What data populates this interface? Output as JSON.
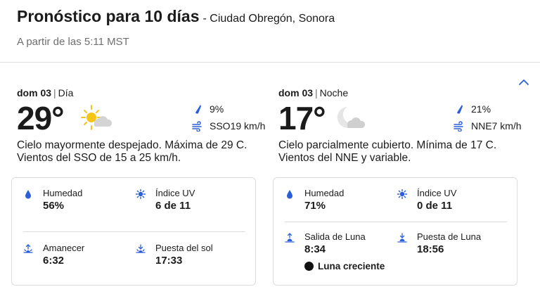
{
  "header": {
    "title": "Pronóstico para 10 días",
    "location": "- Ciudad Obregón, Sonora",
    "subtitle": "A partir de las 5:11 MST"
  },
  "colors": {
    "accent": "#2b5fd9",
    "sun": "#f5c518",
    "cloud": "#d4d4d4"
  },
  "day": {
    "date": "dom 03",
    "separator": "|",
    "period": "Día",
    "temp": "29°",
    "icon": "sun-cloud-icon",
    "precip": "9%",
    "wind": "SSO19 km/h",
    "description": "Cielo mayormente despejado. Máxima de 29 C. Vientos del SSO de 15 a 25 km/h.",
    "details": {
      "humidity_label": "Humedad",
      "humidity": "56%",
      "uv_label": "Índice UV",
      "uv": "6 de 11",
      "sunrise_label": "Amanecer",
      "sunrise": "6:32",
      "sunset_label": "Puesta del sol",
      "sunset": "17:33"
    }
  },
  "night": {
    "date": "dom 03",
    "separator": "|",
    "period": "Noche",
    "temp": "17°",
    "icon": "moon-cloud-icon",
    "precip": "21%",
    "wind": "NNE7 km/h",
    "description": "Cielo parcialmente cubierto. Mínima de 17 C. Vientos del NNE y variable.",
    "details": {
      "humidity_label": "Humedad",
      "humidity": "71%",
      "uv_label": "Índice UV",
      "uv": "0 de 11",
      "moonrise_label": "Salida de Luna",
      "moonrise": "8:34",
      "moonset_label": "Puesta de Luna",
      "moonset": "18:56",
      "moon_phase": "Luna creciente"
    }
  }
}
